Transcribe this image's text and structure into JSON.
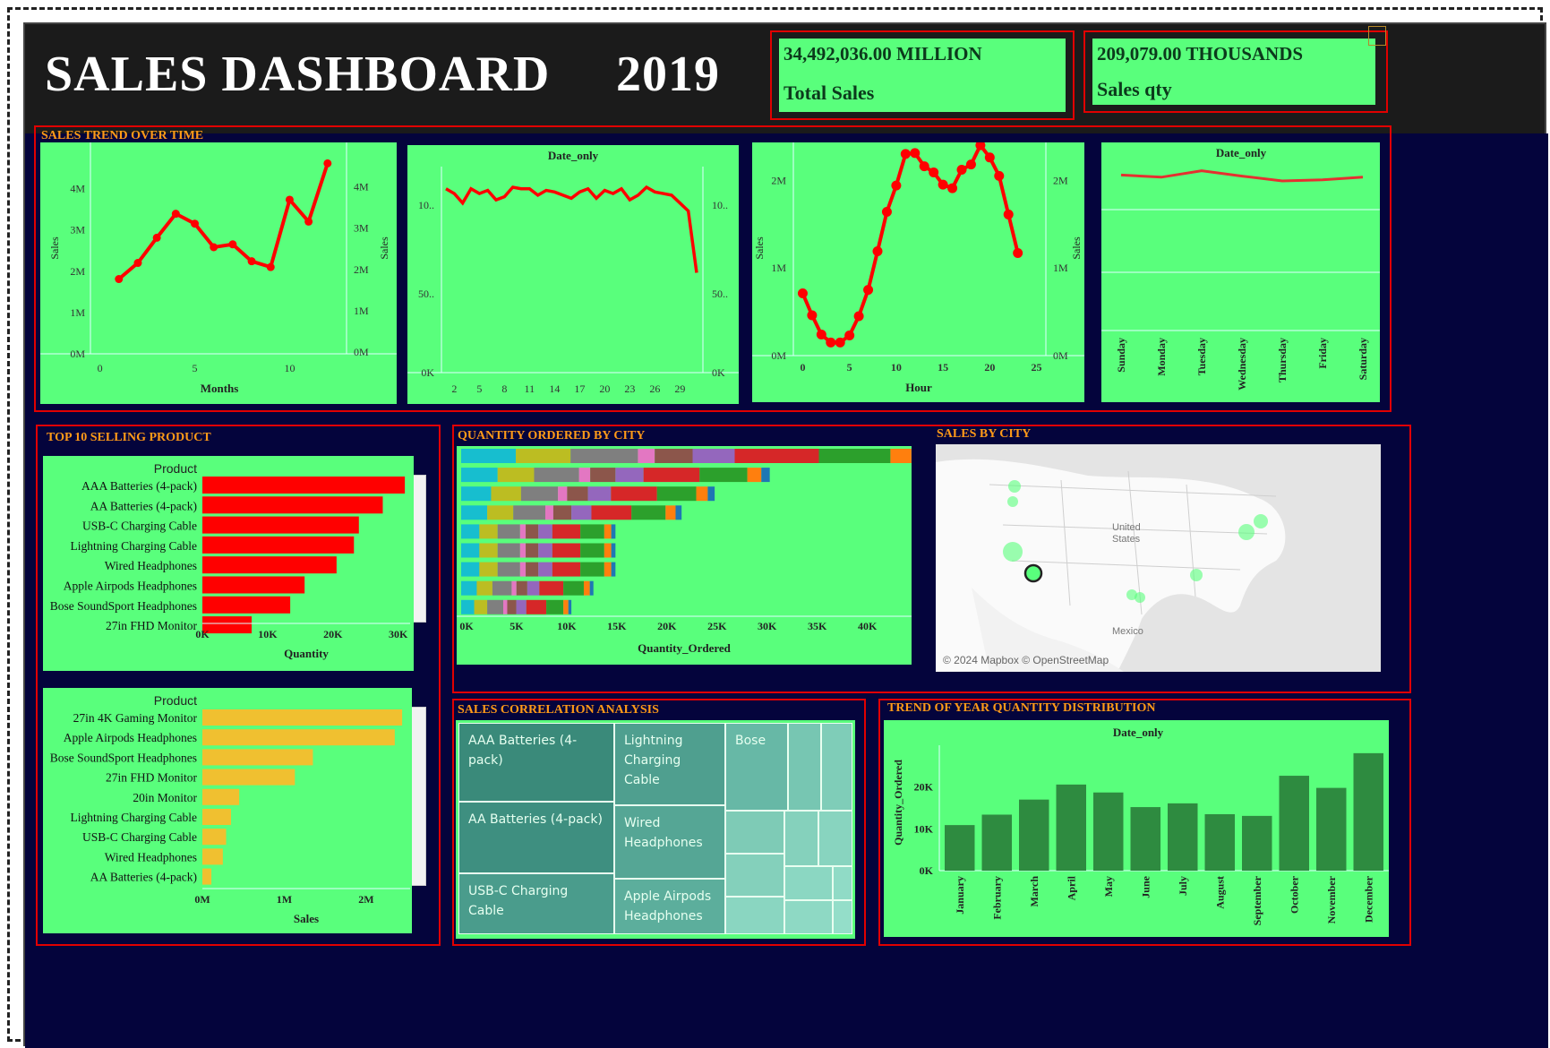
{
  "header": {
    "title": "SALES  DASHBOARD",
    "year": "2019"
  },
  "kpis": [
    {
      "value": "34,492,036.00  MILLION",
      "label": "Total Sales"
    },
    {
      "value": "209,079.00 THOUSANDS",
      "label": "Sales qty"
    }
  ],
  "sections": {
    "trend": "SALES TREND OVER TIME",
    "top10": "TOP 10 SELLING PRODUCT",
    "qty_city": "QUANTITY ORDERED BY CITY",
    "sales_city": "SALES BY CITY",
    "correlation": "SALES CORRELATION ANALYSIS",
    "year_qty": "TREND OF YEAR QUANTITY DISTRIBUTION"
  },
  "colors": {
    "panel_green": "#59ff7c",
    "line_red": "#ff0000",
    "bar_orange": "#f0c030",
    "bar_dark_green": "#2e8b40",
    "title_orange": "#ff9a18"
  },
  "chart_data": [
    {
      "type": "line",
      "name": "sales-by-month",
      "xlabel": "Months",
      "ylabel": "Sales",
      "x": [
        1,
        2,
        3,
        4,
        5,
        6,
        7,
        8,
        9,
        10,
        11,
        12
      ],
      "values": [
        1.81,
        2.2,
        2.81,
        3.39,
        3.15,
        2.58,
        2.65,
        2.24,
        2.1,
        3.73,
        3.2,
        4.61
      ],
      "x_ticks": [
        "0",
        "5",
        "10"
      ],
      "y_ticks": [
        "0M",
        "1M",
        "2M",
        "3M",
        "4M"
      ],
      "xlim": [
        -0.5,
        13
      ],
      "ylim": [
        0,
        4.9
      ]
    },
    {
      "type": "line",
      "name": "sales-by-date",
      "title": "Date_only",
      "x_ticks": [
        "2",
        "5",
        "8",
        "11",
        "14",
        "17",
        "20",
        "23",
        "26",
        "29"
      ],
      "y_ticks": [
        "0K",
        "50..",
        "10.."
      ],
      "values": [
        1.16,
        1.13,
        1.07,
        1.16,
        1.13,
        1.15,
        1.09,
        1.11,
        1.17,
        1.16,
        1.16,
        1.12,
        1.15,
        1.14,
        1.12,
        1.1,
        1.14,
        1.16,
        1.1,
        1.15,
        1.13,
        1.16,
        1.09,
        1.12,
        1.17,
        1.14,
        1.13,
        1.12,
        1.07,
        1.02,
        0.63
      ]
    },
    {
      "type": "line",
      "name": "sales-by-hour",
      "xlabel": "Hour",
      "ylabel": "Sales",
      "x": [
        0,
        1,
        2,
        3,
        4,
        5,
        6,
        7,
        8,
        9,
        10,
        11,
        12,
        13,
        14,
        15,
        16,
        17,
        18,
        19,
        20,
        21,
        22,
        23
      ],
      "values": [
        0.71,
        0.46,
        0.24,
        0.15,
        0.15,
        0.23,
        0.45,
        0.75,
        1.19,
        1.64,
        1.94,
        2.3,
        2.31,
        2.16,
        2.09,
        1.95,
        1.91,
        2.12,
        2.18,
        2.4,
        2.26,
        2.05,
        1.61,
        1.17
      ],
      "x_ticks": [
        "0",
        "5",
        "10",
        "15",
        "20",
        "25"
      ],
      "y_ticks": [
        "0M",
        "1M",
        "2M"
      ],
      "xlim": [
        -1,
        26
      ],
      "ylim": [
        0,
        2.35
      ]
    },
    {
      "type": "line",
      "name": "sales-by-weekday",
      "title": "Date_only",
      "categories": [
        "Sunday",
        "Monday",
        "Tuesday",
        "Wednesday",
        "Thursday",
        "Friday",
        "Saturday"
      ],
      "values": [
        5.06,
        5.02,
        5.14,
        5.04,
        4.95,
        4.97,
        5.02
      ]
    },
    {
      "type": "bar",
      "name": "top10-by-quantity",
      "header": "Product",
      "xlabel": "Quantity",
      "categories": [
        "AAA Batteries (4-pack)",
        "AA Batteries (4-pack)",
        "USB-C Charging Cable",
        "Lightning Charging Cable",
        "Wired Headphones",
        "Apple Airpods Headphones",
        "Bose SoundSport Headphones",
        "27in FHD Monitor"
      ],
      "values": [
        31017,
        27635,
        23975,
        23217,
        20557,
        15661,
        13457,
        7550
      ],
      "x_ticks": [
        "0K",
        "10K",
        "20K",
        "30K"
      ]
    },
    {
      "type": "bar",
      "name": "top10-by-sales",
      "header": "Product",
      "xlabel": "Sales",
      "categories": [
        "27in 4K Gaming Monitor",
        "Apple Airpods Headphones",
        "Bose SoundSport Headphones",
        "27in FHD Monitor",
        "20in Monitor",
        "Lightning Charging Cable",
        "USB-C Charging Cable",
        "Wired Headphones",
        "AA Batteries (4-pack)"
      ],
      "values": [
        2.44,
        2.35,
        1.35,
        1.13,
        0.45,
        0.35,
        0.29,
        0.25,
        0.11
      ],
      "x_ticks": [
        "0M",
        "1M",
        "2M"
      ]
    },
    {
      "type": "bar",
      "name": "quantity-by-city",
      "xlabel": "Quantity_Ordered",
      "values": [
        42,
        28,
        23,
        20,
        14,
        14,
        14,
        12,
        10
      ],
      "x_ticks": [
        "0K",
        "5K",
        "10K",
        "15K",
        "20K",
        "25K",
        "30K",
        "35K",
        "40K"
      ]
    },
    {
      "type": "bar",
      "name": "quantity-by-month",
      "title": "Date_only",
      "ylabel": "Quantity_Ordered",
      "categories": [
        "January",
        "February",
        "March",
        "April",
        "May",
        "June",
        "July",
        "August",
        "September",
        "October",
        "November",
        "December"
      ],
      "values": [
        10.9,
        13.4,
        17.0,
        20.6,
        18.7,
        15.2,
        16.1,
        13.5,
        13.1,
        22.7,
        19.8,
        28.1
      ],
      "y_ticks": [
        "0K",
        "10K",
        "20K"
      ],
      "ylim": [
        0,
        30
      ]
    }
  ],
  "map": {
    "country1": "United States",
    "country2": "Mexico",
    "credit": "© 2024 Mapbox © OpenStreetMap"
  },
  "treemap": {
    "labels": [
      "AAA Batteries (4-pack)",
      "AA Batteries (4-pack)",
      "USB-C Charging Cable",
      "Lightning Charging Cable",
      "Wired Headphones",
      "Apple Airpods Headphones",
      "Bose"
    ]
  }
}
